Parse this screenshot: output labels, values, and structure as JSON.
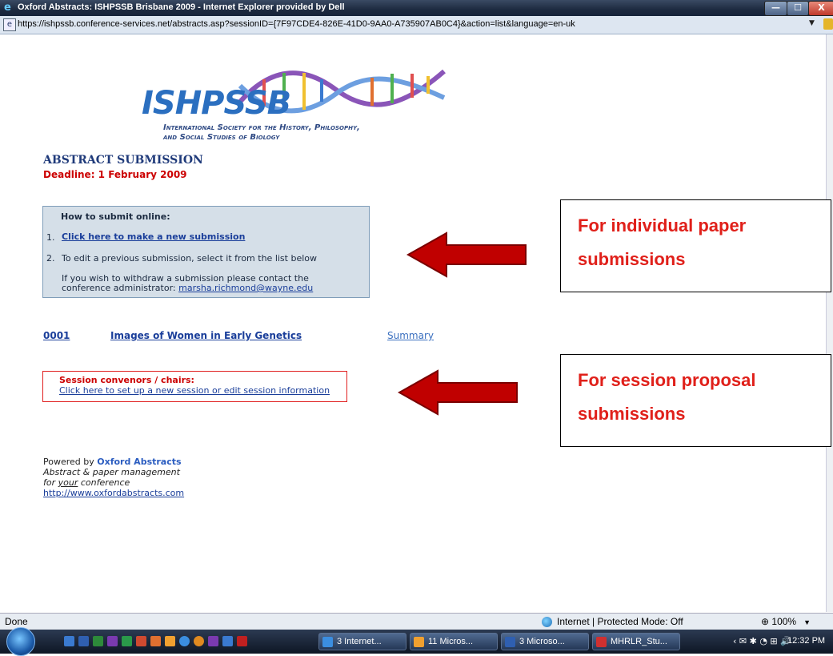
{
  "window": {
    "title": "Oxford Abstracts: ISHPSSB Brisbane 2009 - Internet Explorer provided by Dell",
    "min_glyph": "—",
    "max_glyph": "☐",
    "close_glyph": "X"
  },
  "address_bar": {
    "url": "https://ishpssb.conference-services.net/abstracts.asp?sessionID={7F97CDE4-826E-41D0-9AA0-A735907AB0C4}&action=list&language=en-uk",
    "dropdown_glyph": "▼"
  },
  "logo": {
    "name": "ISHPSSB",
    "subtitle_line1": "International Society for the History, Philosophy,",
    "subtitle_line2": "and Social Studies of Biology"
  },
  "page": {
    "heading": "ABSTRACT SUBMISSION",
    "deadline": "Deadline: 1 February 2009"
  },
  "howto": {
    "title": "How to submit online:",
    "item1_number": "1.",
    "item1_link": "Click here to make a new submission",
    "item2_number": "2.",
    "item2_text": "To edit a previous submission, select it from the list below",
    "withdraw_line1": "If you wish to withdraw a submission please contact the",
    "withdraw_line2_prefix": "conference administrator: ",
    "admin_email": "marsha.richmond@wayne.edu"
  },
  "submissions": [
    {
      "id": "0001",
      "title": "Images of Women in Early Genetics",
      "summary_link": "Summary"
    }
  ],
  "session_box": {
    "title": "Session convenors / chairs:",
    "link": "Click here to set up a new session or edit session information"
  },
  "footer": {
    "powered_prefix": "Powered by ",
    "powered_brand": "Oxford Abstracts",
    "tagline1": "Abstract & paper management",
    "tagline2_prefix": "for ",
    "tagline2_emph": "your",
    "tagline2_suffix": " conference",
    "url": "http://www.oxfordabstracts.com"
  },
  "callouts": [
    {
      "line1": "For individual paper",
      "line2": "submissions"
    },
    {
      "line1": "For session proposal",
      "line2": "submissions"
    }
  ],
  "status_bar": {
    "left_text": "Done",
    "zone_text": "Internet | Protected Mode: Off",
    "zoom_text": "100%",
    "zoom_caret": "▼"
  },
  "taskbar": {
    "tasks": [
      {
        "label": "3 Internet...",
        "icon_color": "#3b8ee0"
      },
      {
        "label": "11 Micros...",
        "icon_color": "#f0a030"
      },
      {
        "label": "3 Microso...",
        "icon_color": "#2f5fb0"
      },
      {
        "label": "MHRLR_Stu...",
        "icon_color": "#d03030"
      }
    ],
    "tray_icons": "‹ ✉ ✱ ◔  ⊞ 🔊",
    "clock": "12:32 PM"
  },
  "colors": {
    "callout_text": "#e0201a",
    "arrow_fill": "#c00000",
    "howto_bg": "#d5dfe8",
    "link": "#1a3e9a"
  }
}
